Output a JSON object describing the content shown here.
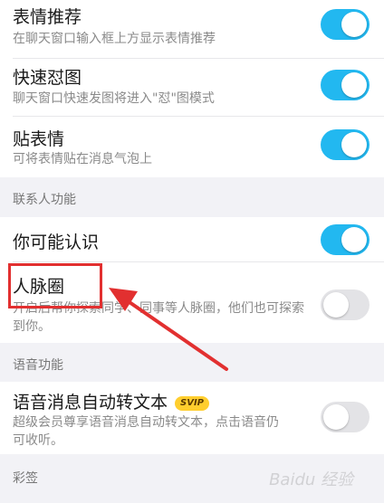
{
  "settings": [
    {
      "title": "表情推荐",
      "description": "在聊天窗口输入框上方显示表情推荐",
      "enabled": true
    },
    {
      "title": "快速怼图",
      "description": "聊天窗口快速发图将进入\"怼\"图模式",
      "enabled": true
    },
    {
      "title": "贴表情",
      "description": "可将表情贴在消息气泡上",
      "enabled": true
    },
    {
      "title": "你可能认识",
      "enabled": true
    },
    {
      "title": "人脉圈",
      "description_line1": "开启后帮你探索同学、同事等人脉圈，他们也可探索",
      "description_line2": "到你。",
      "enabled": false
    },
    {
      "title": "语音消息自动转文本",
      "badge": "SVIP",
      "description_line1": "超级会员尊享语音消息自动转文本，点击语音仍",
      "description_line2": "可收听。",
      "enabled": false
    }
  ],
  "sections": {
    "contacts": "联系人功能",
    "voice": "语音功能",
    "caiqian": "彩签"
  },
  "annotation": {
    "box_color": "#e23030",
    "arrow_color": "#e23030"
  },
  "colors": {
    "toggle_on": "#22b8f0",
    "toggle_off": "#e3e3e6"
  },
  "watermark": "Baidu 经验"
}
